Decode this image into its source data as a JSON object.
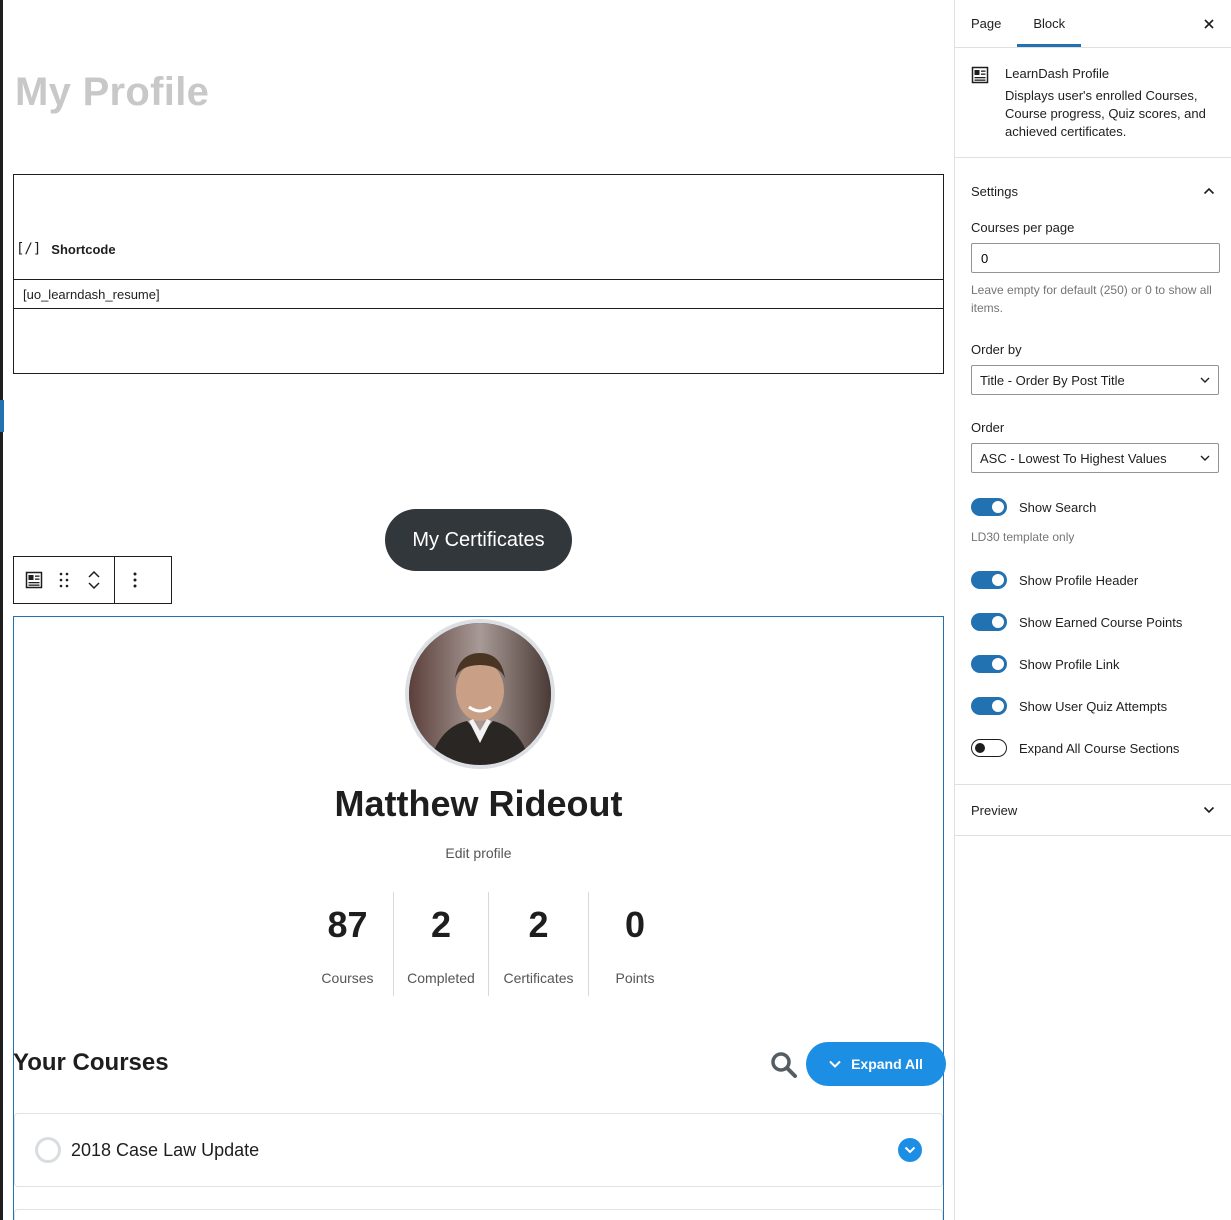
{
  "page": {
    "title": "My Profile"
  },
  "shortcode_block": {
    "label": "Shortcode",
    "icon": "shortcode-icon",
    "value": "[uo_learndash_resume]"
  },
  "certificates_button": {
    "label": "My Certificates"
  },
  "toolbar": {
    "icons": [
      "profile-block-icon",
      "drag-handle-icon",
      "move-up-icon",
      "move-down-icon",
      "more-options-icon"
    ]
  },
  "profile": {
    "name": "Matthew Rideout",
    "edit_link": "Edit profile",
    "stats": [
      {
        "value": "87",
        "label": "Courses"
      },
      {
        "value": "2",
        "label": "Completed"
      },
      {
        "value": "2",
        "label": "Certificates"
      },
      {
        "value": "0",
        "label": "Points"
      }
    ],
    "courses_heading": "Your Courses",
    "expand_all_label": "Expand All",
    "courses": [
      {
        "title": "2018 Case Law Update"
      }
    ]
  },
  "sidebar": {
    "tabs": [
      {
        "label": "Page",
        "active": false
      },
      {
        "label": "Block",
        "active": true
      }
    ],
    "block_card": {
      "title": "LearnDash Profile",
      "description": "Displays user's enrolled Courses, Course progress, Quiz scores, and achieved certificates."
    },
    "settings": {
      "title": "Settings",
      "courses_per_page": {
        "label": "Courses per page",
        "value": "0",
        "help": "Leave empty for default (250) or 0 to show all items."
      },
      "order_by": {
        "label": "Order by",
        "value": "Title - Order By Post Title"
      },
      "order": {
        "label": "Order",
        "value": "ASC - Lowest To Highest Values"
      },
      "show_search": {
        "label": "Show Search",
        "on": true,
        "help": "LD30 template only"
      },
      "toggles": [
        {
          "label": "Show Profile Header",
          "on": true
        },
        {
          "label": "Show Earned Course Points",
          "on": true
        },
        {
          "label": "Show Profile Link",
          "on": true
        },
        {
          "label": "Show User Quiz Attempts",
          "on": true
        },
        {
          "label": "Expand All Course Sections",
          "on": false
        }
      ]
    },
    "preview": {
      "title": "Preview"
    }
  },
  "colors": {
    "accent": "#2271b1",
    "learndash_blue": "#1c8fe5",
    "button_dark": "#32373c",
    "title_muted": "#c8c8c8"
  }
}
